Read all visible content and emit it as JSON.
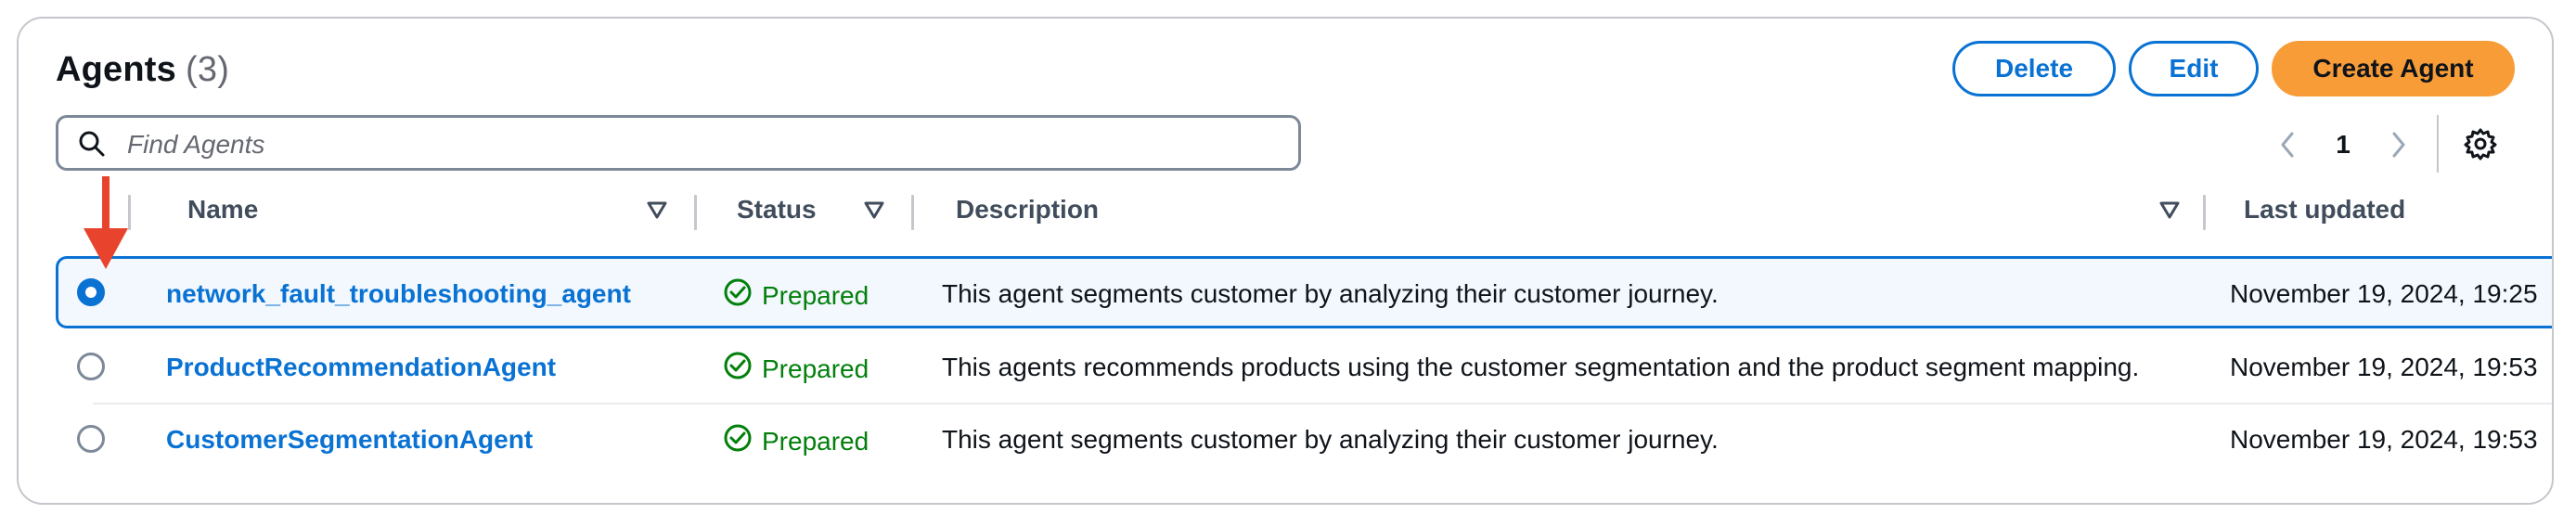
{
  "header": {
    "title": "Agents",
    "count": "(3)",
    "delete_label": "Delete",
    "edit_label": "Edit",
    "create_label": "Create Agent"
  },
  "search": {
    "placeholder": "Find Agents",
    "value": ""
  },
  "pagination": {
    "current_page": "1"
  },
  "columns": {
    "name": "Name",
    "status": "Status",
    "description": "Description",
    "last_updated": "Last updated"
  },
  "rows": [
    {
      "name": "network_fault_troubleshooting_agent",
      "status": "Prepared",
      "description": "This agent segments customer by analyzing their customer journey.",
      "last_updated": "November 19, 2024, 19:25",
      "selected": true
    },
    {
      "name": "ProductRecommendationAgent",
      "status": "Prepared",
      "description": "This agents recommends products using the customer segmentation and the product segment mapping.",
      "last_updated": "November 19, 2024, 19:53",
      "selected": false
    },
    {
      "name": "CustomerSegmentationAgent",
      "status": "Prepared",
      "description": "This agent segments customer by analyzing their customer journey.",
      "last_updated": "November 19, 2024, 19:53",
      "selected": false
    }
  ],
  "colors": {
    "accent": "#0972d3",
    "primary_button": "#f89c38",
    "success": "#037f0c",
    "annotation_arrow": "#e8432c"
  },
  "icons": [
    "search-icon",
    "chevron-left-icon",
    "chevron-right-icon",
    "gear-icon",
    "sort-caret-icon",
    "check-circle-icon",
    "annotation-arrow-icon"
  ]
}
